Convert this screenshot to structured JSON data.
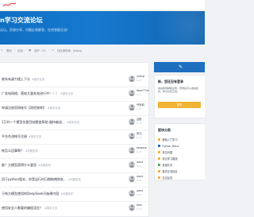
{
  "site": {
    "name": "Python学习交流论坛",
    "title_fragment": "n学习交流论坛",
    "subtitle_fragment": "论坛，资源分享，问题反馈解答，在线答疑交流！"
  },
  "breadcrumb": {
    "home": "首页",
    "forum": "论坛",
    "user": "用户 · 01",
    "section": "社区资料库 · jinbng"
  },
  "threads": [
    {
      "title": "联系有源力理上下分",
      "tag": "#基本交流",
      "user": "jinbng",
      "stats": "0 / 0"
    },
    {
      "title": "广发电网络，营结大量失效进行中！！！",
      "tag": "#基本交流",
      "user": "bkon77ring",
      "stats": "2 / 1"
    },
    {
      "title": "申请注册官网账号【测验致转】",
      "tag": "#基本交流",
      "user": "丹凤和",
      "stats": "1 / 0"
    },
    {
      "title": "1万钓一个模型仿要目结题变帮助-器持者送…",
      "tag": "#基本交流",
      "user": "吕程",
      "stats": "0 / 0"
    },
    {
      "title": "平台合流帐号注册",
      "tag": "#基本交流",
      "user": "张元",
      "stats": "0 / 0"
    },
    {
      "title": "帐怎么回事啊？",
      "tag": "#问题发布",
      "user": "tangaze",
      "stats": "0 / 0"
    },
    {
      "title": "能？大模型获得什么意思",
      "tag": "#问题发布",
      "user": "ward",
      "stats": "0 / 0"
    },
    {
      "title": "用于python版本，你是运行时日期拖拽则失…",
      "tag": "#问题发布",
      "user": "ward",
      "stats": "0 / 0"
    },
    {
      "title": "于帐大模型使用的DeepSeek开始建内容",
      "tag": "#问题发布",
      "user": "ward",
      "stats": "0 / 0"
    },
    {
      "title": "使用安全人都要的编程语言？",
      "tag": "#基本交流",
      "user": "Kokr",
      "stats": "0 / 0"
    }
  ],
  "sidebar": {
    "welcome_title": "新，您还没有登录",
    "welcome_text": "本站使用邮箱注册，登录后可以发帖回复，参与社区互动。",
    "login_button": "登录",
    "categories_title": "版块分类",
    "categories": [
      {
        "label": "基础入门学习",
        "color": "#f2b233"
      },
      {
        "label": "Python_Basic",
        "color": "#1f6fc0"
      },
      {
        "label": "常见问题",
        "color": "#f2b233"
      },
      {
        "label": "常见学习路线",
        "color": "#f2b233"
      },
      {
        "label": "资源共享",
        "color": "#4caf50"
      },
      {
        "label": "基本交流帖区",
        "color": "#f2b233"
      },
      {
        "label": "意见反馈",
        "color": "#f2b233"
      }
    ]
  },
  "colors": {
    "banner": "#1679d0",
    "accent": "#1f6fc0",
    "button": "#f2b233",
    "logo": "#e5484d"
  },
  "icons": {
    "logo": "brush-logo-icon",
    "home": "home-icon",
    "user": "user-icon",
    "section": "folder-icon",
    "edit": "edit-icon"
  }
}
